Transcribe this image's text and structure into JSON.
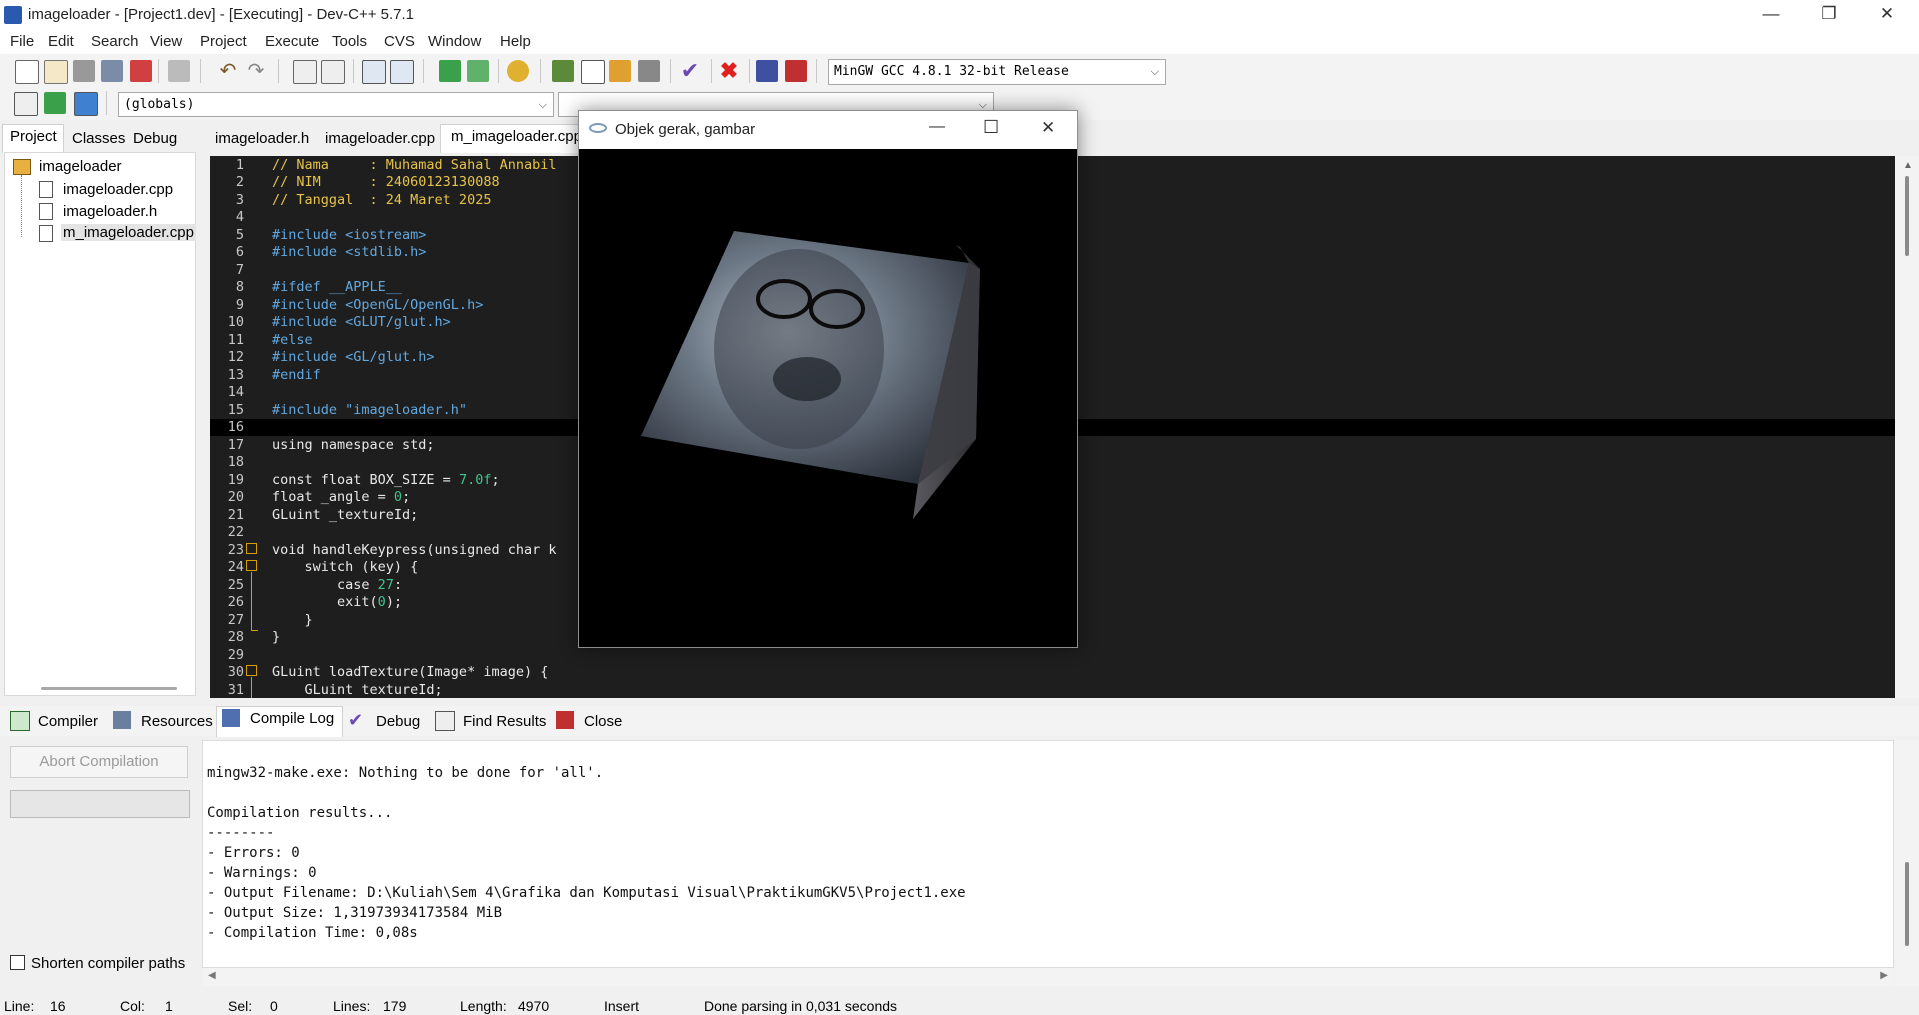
{
  "window": {
    "title": "imageloader - [Project1.dev] - [Executing] - Dev-C++ 5.7.1",
    "minimize": "—",
    "restore": "❐",
    "close": "✕"
  },
  "menu": [
    "File",
    "Edit",
    "Search",
    "View",
    "Project",
    "Execute",
    "Tools",
    "CVS",
    "Window",
    "Help"
  ],
  "toolbar": {
    "compiler_select": "MinGW GCC 4.8.1 32-bit Release",
    "scope_select": "(globals)"
  },
  "left_tabs": [
    "Project",
    "Classes",
    "Debug"
  ],
  "project_tree": {
    "root": "imageloader",
    "files": [
      "imageloader.cpp",
      "imageloader.h",
      "m_imageloader.cpp"
    ]
  },
  "editor_tabs": [
    "imageloader.h",
    "imageloader.cpp",
    "m_imageloader.cpp"
  ],
  "code": {
    "line_numbers": [
      "1",
      "2",
      "3",
      "4",
      "5",
      "6",
      "7",
      "8",
      "9",
      "10",
      "11",
      "12",
      "13",
      "14",
      "15",
      "16",
      "17",
      "18",
      "19",
      "20",
      "21",
      "22",
      "23",
      "24",
      "25",
      "26",
      "27",
      "28",
      "29",
      "30",
      "31"
    ],
    "l1": "// Nama     : Muhamad Sahal Annabil",
    "l2": "// NIM      : 24060123130088",
    "l3": "// Tanggal  : 24 Maret 2025",
    "l5": "#include <iostream>",
    "l6": "#include <stdlib.h>",
    "l8": "#ifdef __APPLE__",
    "l9": "#include <OpenGL/OpenGL.h>",
    "l10": "#include <GLUT/glut.h>",
    "l11": "#else",
    "l12": "#include <GL/glut.h>",
    "l13": "#endif",
    "l15": "#include \"imageloader.h\"",
    "l17": "using namespace std;",
    "l19a": "const float BOX_SIZE = ",
    "l19b": "7.0f",
    "l19c": ";",
    "l20a": "float _angle = ",
    "l20b": "0",
    "l20c": ";",
    "l21": "GLuint _textureId;",
    "l23": "void handleKeypress(unsigned char k",
    "l24": "    switch (key) {",
    "l25a": "        case ",
    "l25b": "27",
    "l25c": ":",
    "l26a": "        exit(",
    "l26b": "0",
    "l26c": ");",
    "l27": "    }",
    "l28": "}",
    "l30": "GLuint loadTexture(Image* image) {",
    "l31": "    GLuint textureId;"
  },
  "bottom_tabs": [
    "Compiler",
    "Resources",
    "Compile Log",
    "Debug",
    "Find Results",
    "Close"
  ],
  "compile_panel": {
    "abort_label": "Abort Compilation",
    "shorten_label": "Shorten compiler paths",
    "log": [
      "mingw32-make.exe: Nothing to be done for 'all'.",
      "",
      "Compilation results...",
      "--------",
      "- Errors: 0",
      "- Warnings: 0",
      "- Output Filename: D:\\Kuliah\\Sem 4\\Grafika dan Komputasi Visual\\PraktikumGKV5\\Project1.exe",
      "- Output Size: 1,31973934173584 MiB",
      "- Compilation Time: 0,08s"
    ]
  },
  "status": {
    "line_label": "Line:",
    "line_value": "16",
    "col_label": "Col:",
    "col_value": "1",
    "sel_label": "Sel:",
    "sel_value": "0",
    "lines_label": "Lines:",
    "lines_value": "179",
    "length_label": "Length:",
    "length_value": "4970",
    "mode": "Insert",
    "message": "Done parsing in 0,031 seconds"
  },
  "popup": {
    "title": "Objek gerak, gambar",
    "minimize": "—",
    "maximize": "☐",
    "close": "✕"
  },
  "colors": {
    "editor_bg": "#1e1e1e",
    "comment": "#e6c34a",
    "preprocessor": "#62a8e0",
    "number": "#3fc48a"
  }
}
